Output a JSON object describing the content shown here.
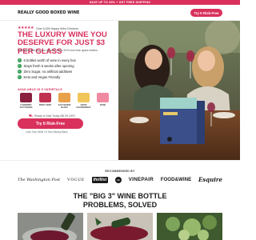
{
  "promo": {
    "text": "SAVE UP TO 30% + GET FREE SHIPPING"
  },
  "header": {
    "logo": "REALLY GOOD BOXED WINE",
    "cta_label": "Try It Risk-Free"
  },
  "hero": {
    "stars": "★★★★★",
    "rating_text": "Over 6,000 Happy Wine Drinkers",
    "headline": "The luxury wine you deserve for just $3 per glass",
    "subtext": "Fine wine that fits your life and costs 90% less than glass bottles.",
    "features": [
      "6 bottles worth of wine in every box",
      "Stays fresh 6 weeks after opening",
      "Zero Sugar, no artificial additives",
      "Keto and Vegan Friendly"
    ],
    "varietals_label": "AVAILABLE IN 5 VARIETALS",
    "varietals": [
      {
        "name": "CABERNET SAUVIGNON",
        "color": "#8a1f3f"
      },
      {
        "name": "PINOT NOIR",
        "color": "#c0314f"
      },
      {
        "name": "SAUVIGNON BLANC",
        "color": "#e9a04a"
      },
      {
        "name": "CRISP CHARDONNAY",
        "color": "#f0c65a"
      },
      {
        "name": "ROSÉ",
        "color": "#f08aa0"
      }
    ],
    "ship_note": "Ready to Ship Today ($5.99 CAP)",
    "cta_label": "Try It Risk-Free",
    "cta_note": "Love Your Wine Or Your Money Back"
  },
  "press": {
    "label": "RECOMMENDED BY",
    "logos": [
      "The Washington Post",
      "VOGUE",
      "thrillist",
      "SE",
      "VINEPAIR",
      "FOOD&WINE",
      "Esquire"
    ]
  },
  "problems": {
    "title_line1": "The \"Big 3\" wine bottle",
    "title_line2": "problems, solved"
  },
  "colors": {
    "brand": "#d9305c",
    "check": "#3da35d",
    "text": "#1d1d1d"
  }
}
